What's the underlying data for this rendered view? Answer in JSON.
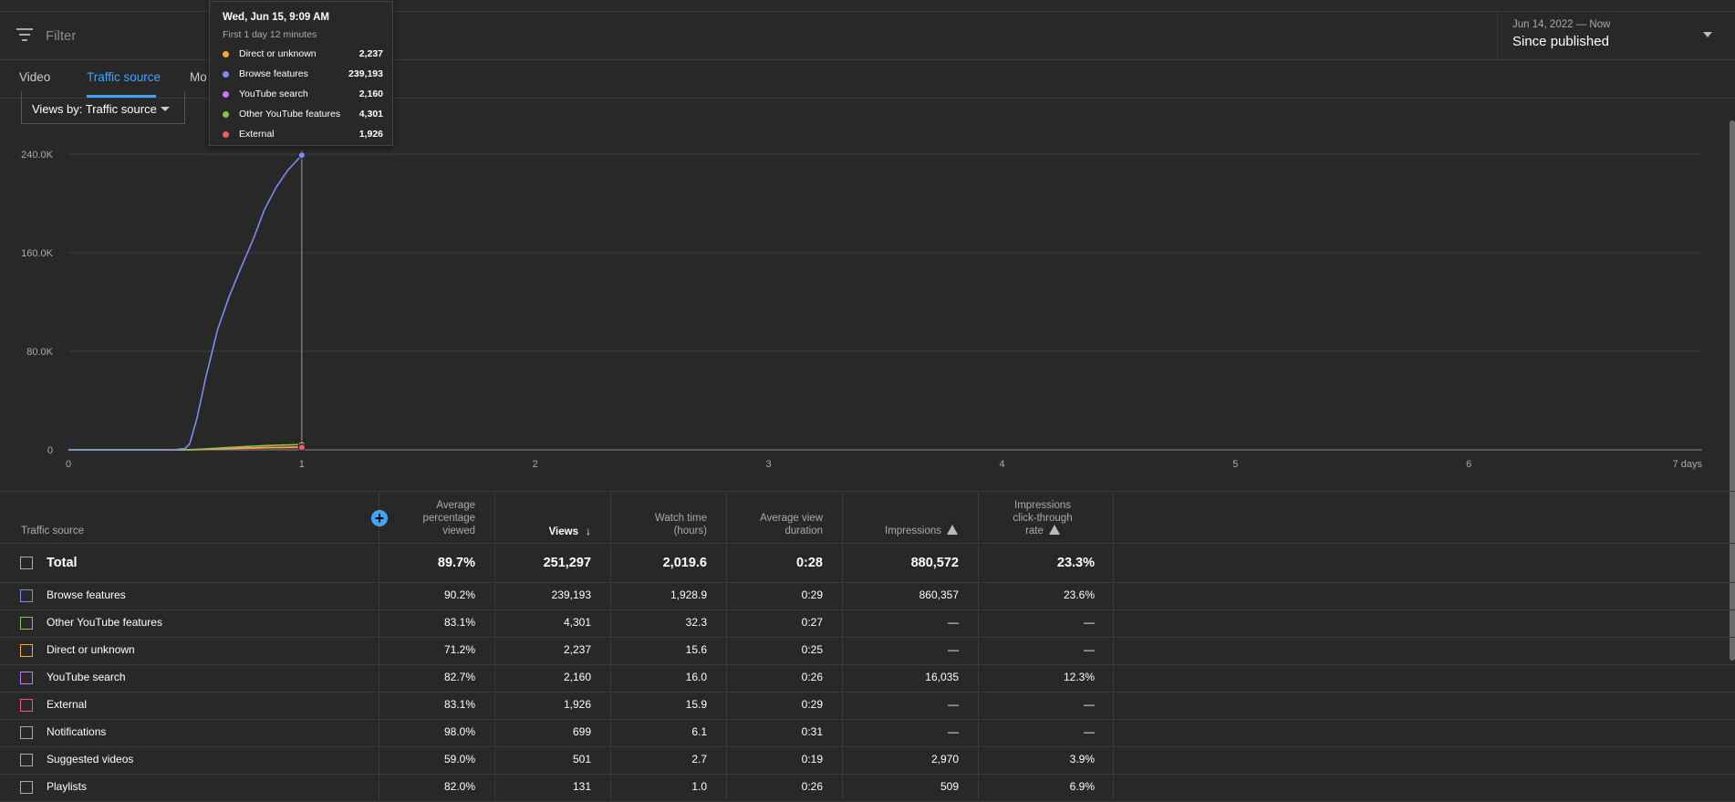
{
  "filter": {
    "placeholder": "Filter"
  },
  "date_picker": {
    "range": "Jun 14, 2022 — Now",
    "title": "Since published"
  },
  "tabs": [
    {
      "label": "Video",
      "active": false
    },
    {
      "label": "Traffic source",
      "active": true
    },
    {
      "label": "Mo",
      "active": false
    }
  ],
  "views_select": {
    "label": "Views by: Traffic source"
  },
  "tooltip": {
    "title": "Wed, Jun 15, 9:09 AM",
    "subtitle": "First 1 day 12 minutes",
    "rows": [
      {
        "name": "Direct or unknown",
        "value": "2,237",
        "color": "#f4a935"
      },
      {
        "name": "Browse features",
        "value": "239,193",
        "color": "#7b8ef0"
      },
      {
        "name": "YouTube search",
        "value": "2,160",
        "color": "#c77ae8"
      },
      {
        "name": "Other YouTube features",
        "value": "4,301",
        "color": "#8bc34a"
      },
      {
        "name": "External",
        "value": "1,926",
        "color": "#ef5c6e"
      }
    ]
  },
  "chart_data": {
    "type": "line",
    "xlabel": "",
    "ylabel": "",
    "x_ticks": [
      "0",
      "1",
      "2",
      "3",
      "4",
      "5",
      "6",
      "7 days"
    ],
    "y_ticks": [
      "0",
      "80.0K",
      "160.0K",
      "240.0K"
    ],
    "xlim": [
      0,
      7
    ],
    "ylim": [
      0,
      240000
    ],
    "grid": true,
    "hover_x": 1,
    "series": [
      {
        "name": "Browse features",
        "color": "#7b8ef0",
        "x": [
          0,
          0.45,
          0.5,
          0.52,
          0.55,
          0.59,
          0.64,
          0.69,
          0.74,
          0.79,
          0.84,
          0.89,
          0.94,
          1.0
        ],
        "y": [
          0,
          0,
          1000,
          5000,
          25000,
          60000,
          98000,
          125000,
          148000,
          170000,
          195000,
          213000,
          227000,
          239193
        ]
      },
      {
        "name": "Other YouTube features",
        "color": "#8bc34a",
        "x": [
          0,
          0.5,
          0.55,
          0.65,
          0.75,
          0.85,
          1.0
        ],
        "y": [
          0,
          0,
          300,
          1500,
          2600,
          3500,
          4301
        ]
      },
      {
        "name": "Direct or unknown",
        "color": "#f4a935",
        "x": [
          0,
          0.5,
          0.55,
          0.65,
          0.75,
          0.85,
          1.0
        ],
        "y": [
          0,
          0,
          200,
          900,
          1500,
          1900,
          2237
        ]
      },
      {
        "name": "YouTube search",
        "color": "#c77ae8",
        "x": [
          0,
          0.5,
          0.55,
          0.65,
          0.75,
          0.85,
          1.0
        ],
        "y": [
          0,
          0,
          150,
          800,
          1400,
          1800,
          2160
        ]
      },
      {
        "name": "External",
        "color": "#ef5c6e",
        "x": [
          0,
          0.5,
          0.55,
          0.65,
          0.75,
          0.85,
          1.0
        ],
        "y": [
          0,
          0,
          150,
          700,
          1200,
          1600,
          1926
        ]
      }
    ]
  },
  "table": {
    "headers": {
      "source": "Traffic source",
      "avg_pct": [
        "Average",
        "percentage",
        "viewed"
      ],
      "views": "Views",
      "watch": [
        "Watch time",
        "(hours)"
      ],
      "avg_dur": [
        "Average view",
        "duration"
      ],
      "impressions": "Impressions",
      "ctr": [
        "Impressions",
        "click-through",
        "rate"
      ]
    },
    "total": {
      "name": "Total",
      "avg_pct": "89.7%",
      "views": "251,297",
      "watch": "2,019.6",
      "avg_dur": "0:28",
      "impressions": "880,572",
      "ctr": "23.3%"
    },
    "rows": [
      {
        "name": "Browse features",
        "color": "#7b8ef0",
        "avg_pct": "90.2%",
        "views": "239,193",
        "watch": "1,928.9",
        "avg_dur": "0:29",
        "impressions": "860,357",
        "ctr": "23.6%"
      },
      {
        "name": "Other YouTube features",
        "color": "#8bc34a",
        "avg_pct": "83.1%",
        "views": "4,301",
        "watch": "32.3",
        "avg_dur": "0:27",
        "impressions": "—",
        "ctr": "—"
      },
      {
        "name": "Direct or unknown",
        "color": "#f4a935",
        "avg_pct": "71.2%",
        "views": "2,237",
        "watch": "15.6",
        "avg_dur": "0:25",
        "impressions": "—",
        "ctr": "—"
      },
      {
        "name": "YouTube search",
        "color": "#c77ae8",
        "avg_pct": "82.7%",
        "views": "2,160",
        "watch": "16.0",
        "avg_dur": "0:26",
        "impressions": "16,035",
        "ctr": "12.3%"
      },
      {
        "name": "External",
        "color": "#ef5c6e",
        "avg_pct": "83.1%",
        "views": "1,926",
        "watch": "15.9",
        "avg_dur": "0:29",
        "impressions": "—",
        "ctr": "—"
      },
      {
        "name": "Notifications",
        "color": "#aaaaaa",
        "avg_pct": "98.0%",
        "views": "699",
        "watch": "6.1",
        "avg_dur": "0:31",
        "impressions": "—",
        "ctr": "—"
      },
      {
        "name": "Suggested videos",
        "color": "#aaaaaa",
        "avg_pct": "59.0%",
        "views": "501",
        "watch": "2.7",
        "avg_dur": "0:19",
        "impressions": "2,970",
        "ctr": "3.9%"
      },
      {
        "name": "Playlists",
        "color": "#aaaaaa",
        "avg_pct": "82.0%",
        "views": "131",
        "watch": "1.0",
        "avg_dur": "0:26",
        "impressions": "509",
        "ctr": "6.9%"
      }
    ]
  }
}
